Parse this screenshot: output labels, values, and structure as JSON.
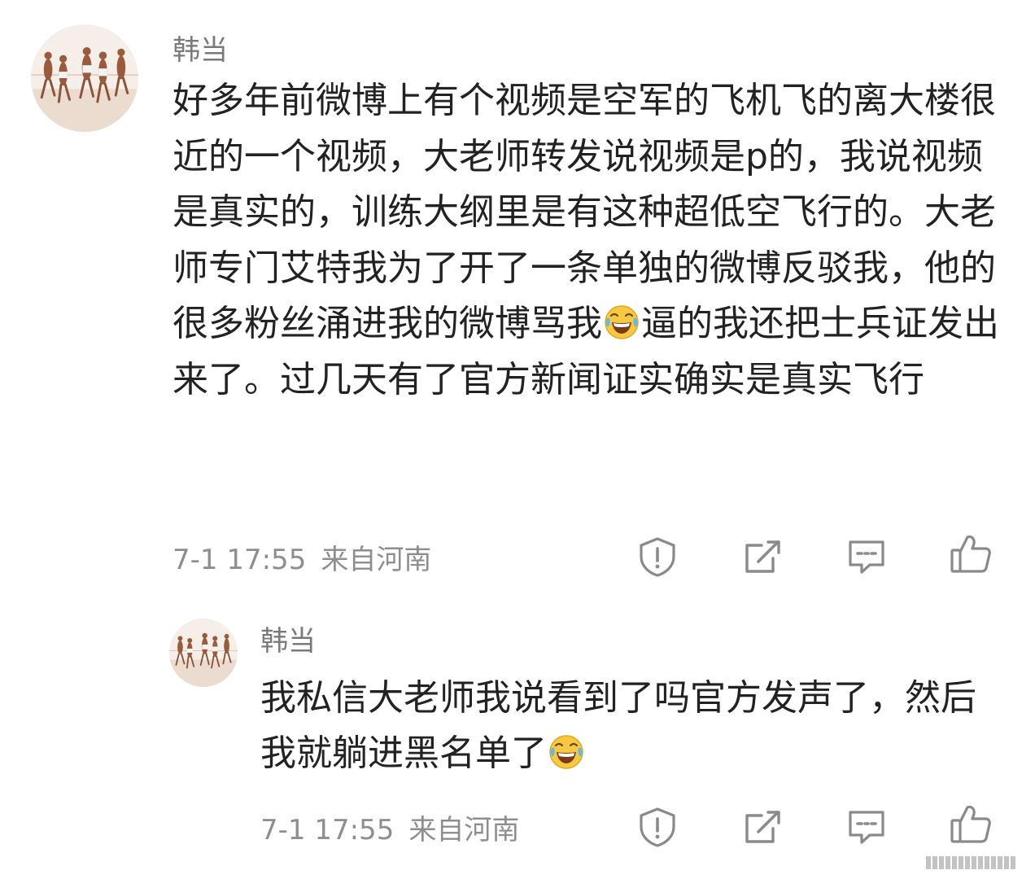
{
  "comments": [
    {
      "username": "韩当",
      "text_parts": [
        "好多年前微博上有个视频是空军的飞机飞的离大楼很近的一个视频，大老师转发说视频是p的，我说视频是真实的，训练大纲里是有这种超低空飞行的。大老师专门艾特我为了开了一条单独的微博反驳我，他的很多粉丝涌进我的微博骂我",
        "逼的我还把士兵证发出来了。过几天有了官方新闻证实确实是真实飞行"
      ],
      "emoji": "laugh-cry-emoji",
      "time": "7-1 17:55",
      "location": "来自河南"
    },
    {
      "username": "韩当",
      "text_parts": [
        "我私信大老师我说看到了吗官方发声了，然后我就躺进黑名单了",
        ""
      ],
      "emoji": "laugh-cry-emoji",
      "time": "7-1 17:55",
      "location": "来自河南"
    }
  ],
  "actions": [
    "report-icon",
    "repost-icon",
    "reply-icon",
    "like-icon"
  ],
  "colors": {
    "text": "#222222",
    "username": "#7a7a7a",
    "meta": "#8e8e8e",
    "icon": "#8a8a8a",
    "emoji_face": "#f7c842"
  }
}
